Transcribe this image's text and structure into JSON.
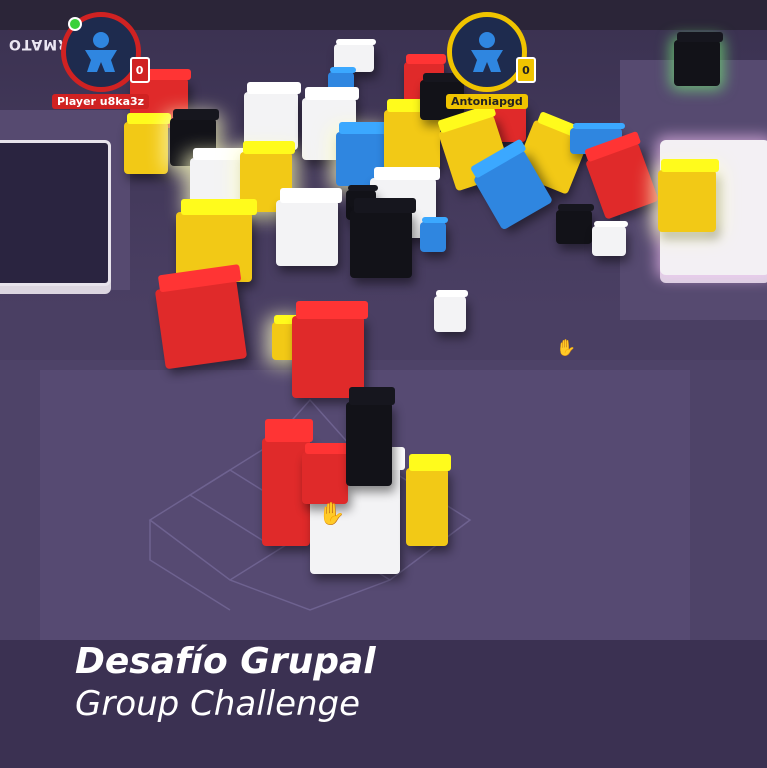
{
  "players": [
    {
      "name": "Player u8ka3z",
      "score": "0",
      "color": "#d02222"
    },
    {
      "name": "Antoniapgd",
      "score": "0",
      "color": "#f0c400"
    }
  ],
  "banner_text": "FORMATO",
  "caption": {
    "line1": "Desafío Grupal",
    "line2": "Group Challenge"
  },
  "icons": [
    "meeple-icon",
    "meeple-icon",
    "hand-cursor-icon",
    "hand-cursor-icon",
    "online-status-icon"
  ],
  "colors": {
    "red": "#e02a2a",
    "yellow": "#f2c916",
    "blue": "#2f86e0",
    "black": "#121218",
    "white": "#f3f3f5",
    "table": "#4b4065"
  }
}
